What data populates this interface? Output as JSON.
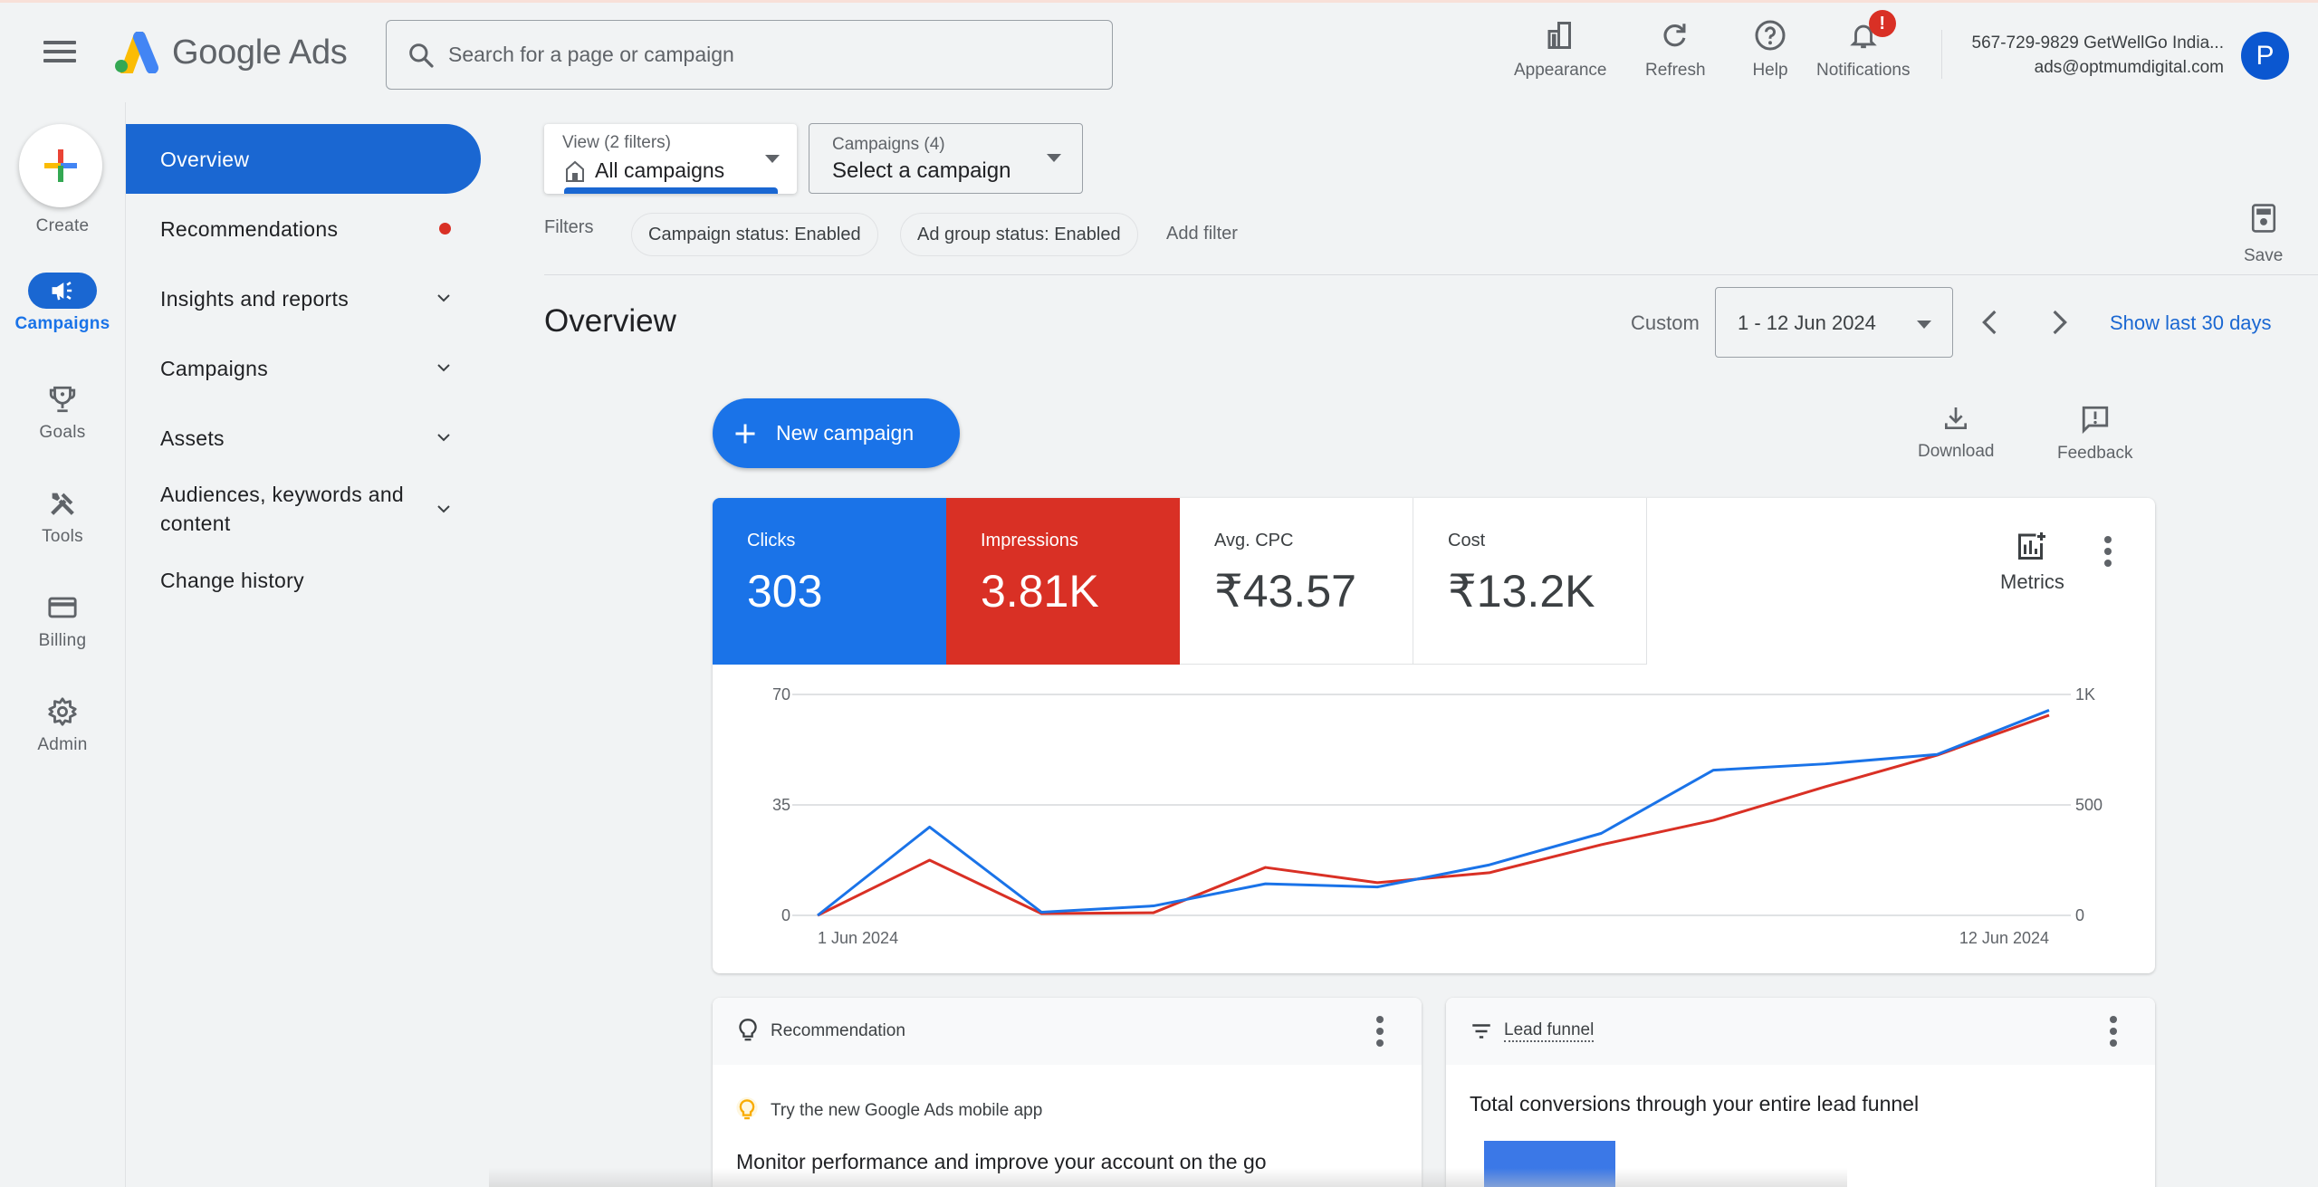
{
  "header": {
    "app_name": "Google Ads",
    "search_placeholder": "Search for a page or campaign",
    "buttons": [
      {
        "label": "Appearance",
        "icon": "appearance-icon"
      },
      {
        "label": "Refresh",
        "icon": "refresh-icon"
      },
      {
        "label": "Help",
        "icon": "help-icon"
      },
      {
        "label": "Notifications",
        "icon": "bell-icon",
        "badge": "!"
      }
    ],
    "account": {
      "name": "567-729-9829 GetWellGo India...",
      "email": "ads@optmumdigital.com",
      "avatar_letter": "P"
    }
  },
  "rail": {
    "create_label": "Create",
    "items": [
      {
        "label": "Campaigns",
        "icon": "megaphone-icon",
        "active": true
      },
      {
        "label": "Goals",
        "icon": "trophy-icon"
      },
      {
        "label": "Tools",
        "icon": "tools-icon"
      },
      {
        "label": "Billing",
        "icon": "credit-card-icon"
      },
      {
        "label": "Admin",
        "icon": "gear-icon"
      }
    ]
  },
  "sidenav": {
    "items": [
      {
        "label": "Overview",
        "active": true
      },
      {
        "label": "Recommendations",
        "indicator": "red-dot"
      },
      {
        "label": "Insights and reports",
        "expandable": true
      },
      {
        "label": "Campaigns",
        "expandable": true
      },
      {
        "label": "Assets",
        "expandable": true
      },
      {
        "label": "Audiences, keywords and content",
        "expandable": true
      },
      {
        "label": "Change history"
      }
    ]
  },
  "toolbar": {
    "view_selector": {
      "sublabel": "View (2 filters)",
      "value": "All campaigns"
    },
    "campaign_selector": {
      "sublabel": "Campaigns (4)",
      "value": "Select a campaign"
    },
    "filters_label": "Filters",
    "filter_chips": [
      "Campaign status: Enabled",
      "Ad group status: Enabled"
    ],
    "add_filter": "Add filter",
    "save_label": "Save"
  },
  "main": {
    "title": "Overview",
    "date_mode": "Custom",
    "date_range": "1 - 12 Jun 2024",
    "show_last_30": "Show last 30 days",
    "new_campaign": "New campaign",
    "download_label": "Download",
    "feedback_label": "Feedback"
  },
  "scorecards": [
    {
      "label": "Clicks",
      "value": "303",
      "color": "#1a73e8"
    },
    {
      "label": "Impressions",
      "value": "3.81K",
      "color": "#d93025"
    },
    {
      "label": "Avg. CPC",
      "value": "₹43.57"
    },
    {
      "label": "Cost",
      "value": "₹13.2K"
    }
  ],
  "metrics_label": "Metrics",
  "chart_data": {
    "type": "line",
    "title": "",
    "x": [
      "1 Jun 2024",
      "2 Jun 2024",
      "3 Jun 2024",
      "4 Jun 2024",
      "5 Jun 2024",
      "6 Jun 2024",
      "7 Jun 2024",
      "8 Jun 2024",
      "9 Jun 2024",
      "10 Jun 2024",
      "11 Jun 2024",
      "12 Jun 2024"
    ],
    "x_tick_labels": {
      "first": "1 Jun 2024",
      "last": "12 Jun 2024"
    },
    "series": [
      {
        "name": "Clicks",
        "axis": "left",
        "color": "#1a73e8",
        "values": [
          0,
          28,
          1,
          3,
          10,
          9,
          16,
          26,
          46,
          48,
          51,
          65
        ]
      },
      {
        "name": "Impressions",
        "axis": "right",
        "color": "#d93025",
        "values": [
          0,
          250,
          8,
          12,
          217,
          148,
          193,
          320,
          430,
          582,
          725,
          906
        ]
      }
    ],
    "left_axis": {
      "ticks": [
        "0",
        "35",
        "70"
      ],
      "range": [
        0,
        70
      ]
    },
    "right_axis": {
      "ticks": [
        "0",
        "500",
        "1K"
      ],
      "range": [
        0,
        1000
      ]
    },
    "grid": true,
    "legend": "none"
  },
  "recommendation_card": {
    "title": "Recommendation",
    "subtitle": "Try the new Google Ads mobile app",
    "headline": "Monitor performance and improve your account on the go"
  },
  "funnel_card": {
    "title": "Lead funnel",
    "headline": "Total conversions through your entire lead funnel"
  }
}
